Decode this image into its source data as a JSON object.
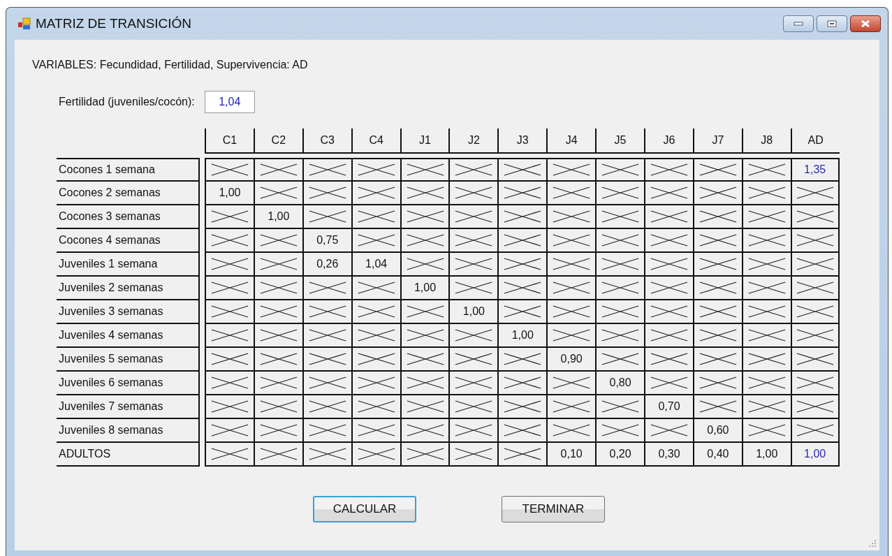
{
  "window": {
    "title": "MATRIZ DE TRANSICIÓN"
  },
  "variables_label": "VARIABLES: Fecundidad, Fertilidad, Supervivencia: AD",
  "fertility_field": {
    "label": "Fertilidad (juveniles/cocón):",
    "value": "1,04"
  },
  "matrix": {
    "columns": [
      "C1",
      "C2",
      "C3",
      "C4",
      "J1",
      "J2",
      "J3",
      "J4",
      "J5",
      "J6",
      "J7",
      "J8",
      "AD"
    ],
    "rows": [
      {
        "label": "Cocones 1 semana",
        "cells": [
          null,
          null,
          null,
          null,
          null,
          null,
          null,
          null,
          null,
          null,
          null,
          null,
          {
            "value": "1,35",
            "editable": true
          }
        ]
      },
      {
        "label": "Cocones 2 semanas",
        "cells": [
          {
            "value": "1,00",
            "editable": false
          },
          null,
          null,
          null,
          null,
          null,
          null,
          null,
          null,
          null,
          null,
          null,
          null
        ]
      },
      {
        "label": "Cocones 3 semanas",
        "cells": [
          null,
          {
            "value": "1,00",
            "editable": false
          },
          null,
          null,
          null,
          null,
          null,
          null,
          null,
          null,
          null,
          null,
          null
        ]
      },
      {
        "label": "Cocones 4 semanas",
        "cells": [
          null,
          null,
          {
            "value": "0,75",
            "editable": false
          },
          null,
          null,
          null,
          null,
          null,
          null,
          null,
          null,
          null,
          null
        ]
      },
      {
        "label": "Juveniles 1 semana",
        "cells": [
          null,
          null,
          {
            "value": "0,26",
            "editable": false
          },
          {
            "value": "1,04",
            "editable": false
          },
          null,
          null,
          null,
          null,
          null,
          null,
          null,
          null,
          null
        ]
      },
      {
        "label": "Juveniles 2 semanas",
        "cells": [
          null,
          null,
          null,
          null,
          {
            "value": "1,00",
            "editable": false
          },
          null,
          null,
          null,
          null,
          null,
          null,
          null,
          null
        ]
      },
      {
        "label": "Juveniles 3 semanas",
        "cells": [
          null,
          null,
          null,
          null,
          null,
          {
            "value": "1,00",
            "editable": false
          },
          null,
          null,
          null,
          null,
          null,
          null,
          null
        ]
      },
      {
        "label": "Juveniles 4 semanas",
        "cells": [
          null,
          null,
          null,
          null,
          null,
          null,
          {
            "value": "1,00",
            "editable": false
          },
          null,
          null,
          null,
          null,
          null,
          null
        ]
      },
      {
        "label": "Juveniles 5 semanas",
        "cells": [
          null,
          null,
          null,
          null,
          null,
          null,
          null,
          {
            "value": "0,90",
            "editable": false
          },
          null,
          null,
          null,
          null,
          null
        ]
      },
      {
        "label": "Juveniles 6 semanas",
        "cells": [
          null,
          null,
          null,
          null,
          null,
          null,
          null,
          null,
          {
            "value": "0,80",
            "editable": false
          },
          null,
          null,
          null,
          null
        ]
      },
      {
        "label": "Juveniles 7 semanas",
        "cells": [
          null,
          null,
          null,
          null,
          null,
          null,
          null,
          null,
          null,
          {
            "value": "0,70",
            "editable": false
          },
          null,
          null,
          null
        ]
      },
      {
        "label": "Juveniles 8 semanas",
        "cells": [
          null,
          null,
          null,
          null,
          null,
          null,
          null,
          null,
          null,
          null,
          {
            "value": "0,60",
            "editable": false
          },
          null,
          null
        ]
      },
      {
        "label": "ADULTOS",
        "cells": [
          null,
          null,
          null,
          null,
          null,
          null,
          null,
          {
            "value": "0,10",
            "editable": false
          },
          {
            "value": "0,20",
            "editable": false
          },
          {
            "value": "0,30",
            "editable": false
          },
          {
            "value": "0,40",
            "editable": false
          },
          {
            "value": "1,00",
            "editable": false
          },
          {
            "value": "1,00",
            "editable": true
          }
        ]
      }
    ]
  },
  "buttons": [
    {
      "label": "CALCULAR",
      "focused": true
    },
    {
      "label": "TERMINAR",
      "focused": false
    }
  ]
}
